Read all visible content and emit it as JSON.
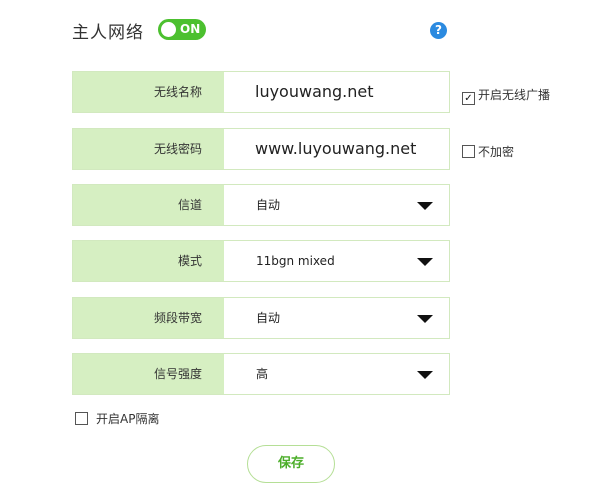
{
  "header": {
    "title": "主人网络",
    "toggle_label": "ON",
    "help_label": "?"
  },
  "fields": [
    {
      "label": "无线名称",
      "value": "luyouwang.net"
    },
    {
      "label": "无线密码",
      "value": "www.luyouwang.net"
    },
    {
      "label": "信道",
      "value": "自动"
    },
    {
      "label": "模式",
      "value": "11bgn mixed"
    },
    {
      "label": "频段带宽",
      "value": "自动"
    },
    {
      "label": "信号强度",
      "value": "高"
    }
  ],
  "options": {
    "broadcast": {
      "label": "开启无线广播",
      "checked": true,
      "mark": "✓"
    },
    "no_encrypt": {
      "label": "不加密",
      "checked": false
    },
    "ap_isolation": {
      "label": "开启AP隔离",
      "checked": false
    }
  },
  "save_label": "保存",
  "colors": {
    "toggle_on": "#4cc02f",
    "label_bg": "#d6efc2",
    "border": "#d2e9bf",
    "help": "#2b8ae0",
    "save_text": "#4cae2a"
  }
}
